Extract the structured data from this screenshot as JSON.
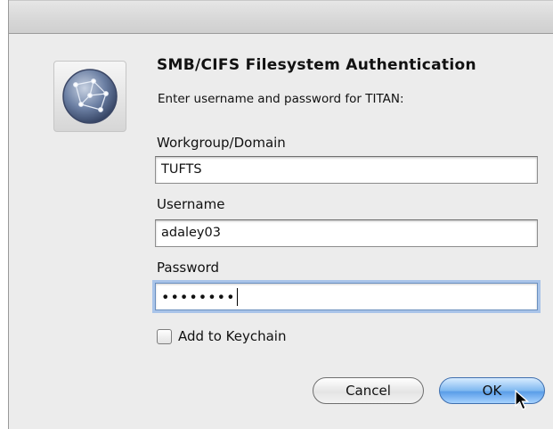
{
  "dialog": {
    "title": "SMB/CIFS Filesystem Authentication",
    "subtitle": "Enter username and password for TITAN:",
    "icon": "network-globe-icon"
  },
  "fields": {
    "workgroup": {
      "label": "Workgroup/Domain",
      "value": "TUFTS"
    },
    "username": {
      "label": "Username",
      "value": "adaley03"
    },
    "password": {
      "label": "Password",
      "masked_value": "••••••••"
    }
  },
  "keychain": {
    "label": "Add to Keychain",
    "checked": false
  },
  "buttons": {
    "cancel": "Cancel",
    "ok": "OK"
  },
  "colors": {
    "focus_ring": "#a9c4e9",
    "default_button": "#5a9de8"
  }
}
